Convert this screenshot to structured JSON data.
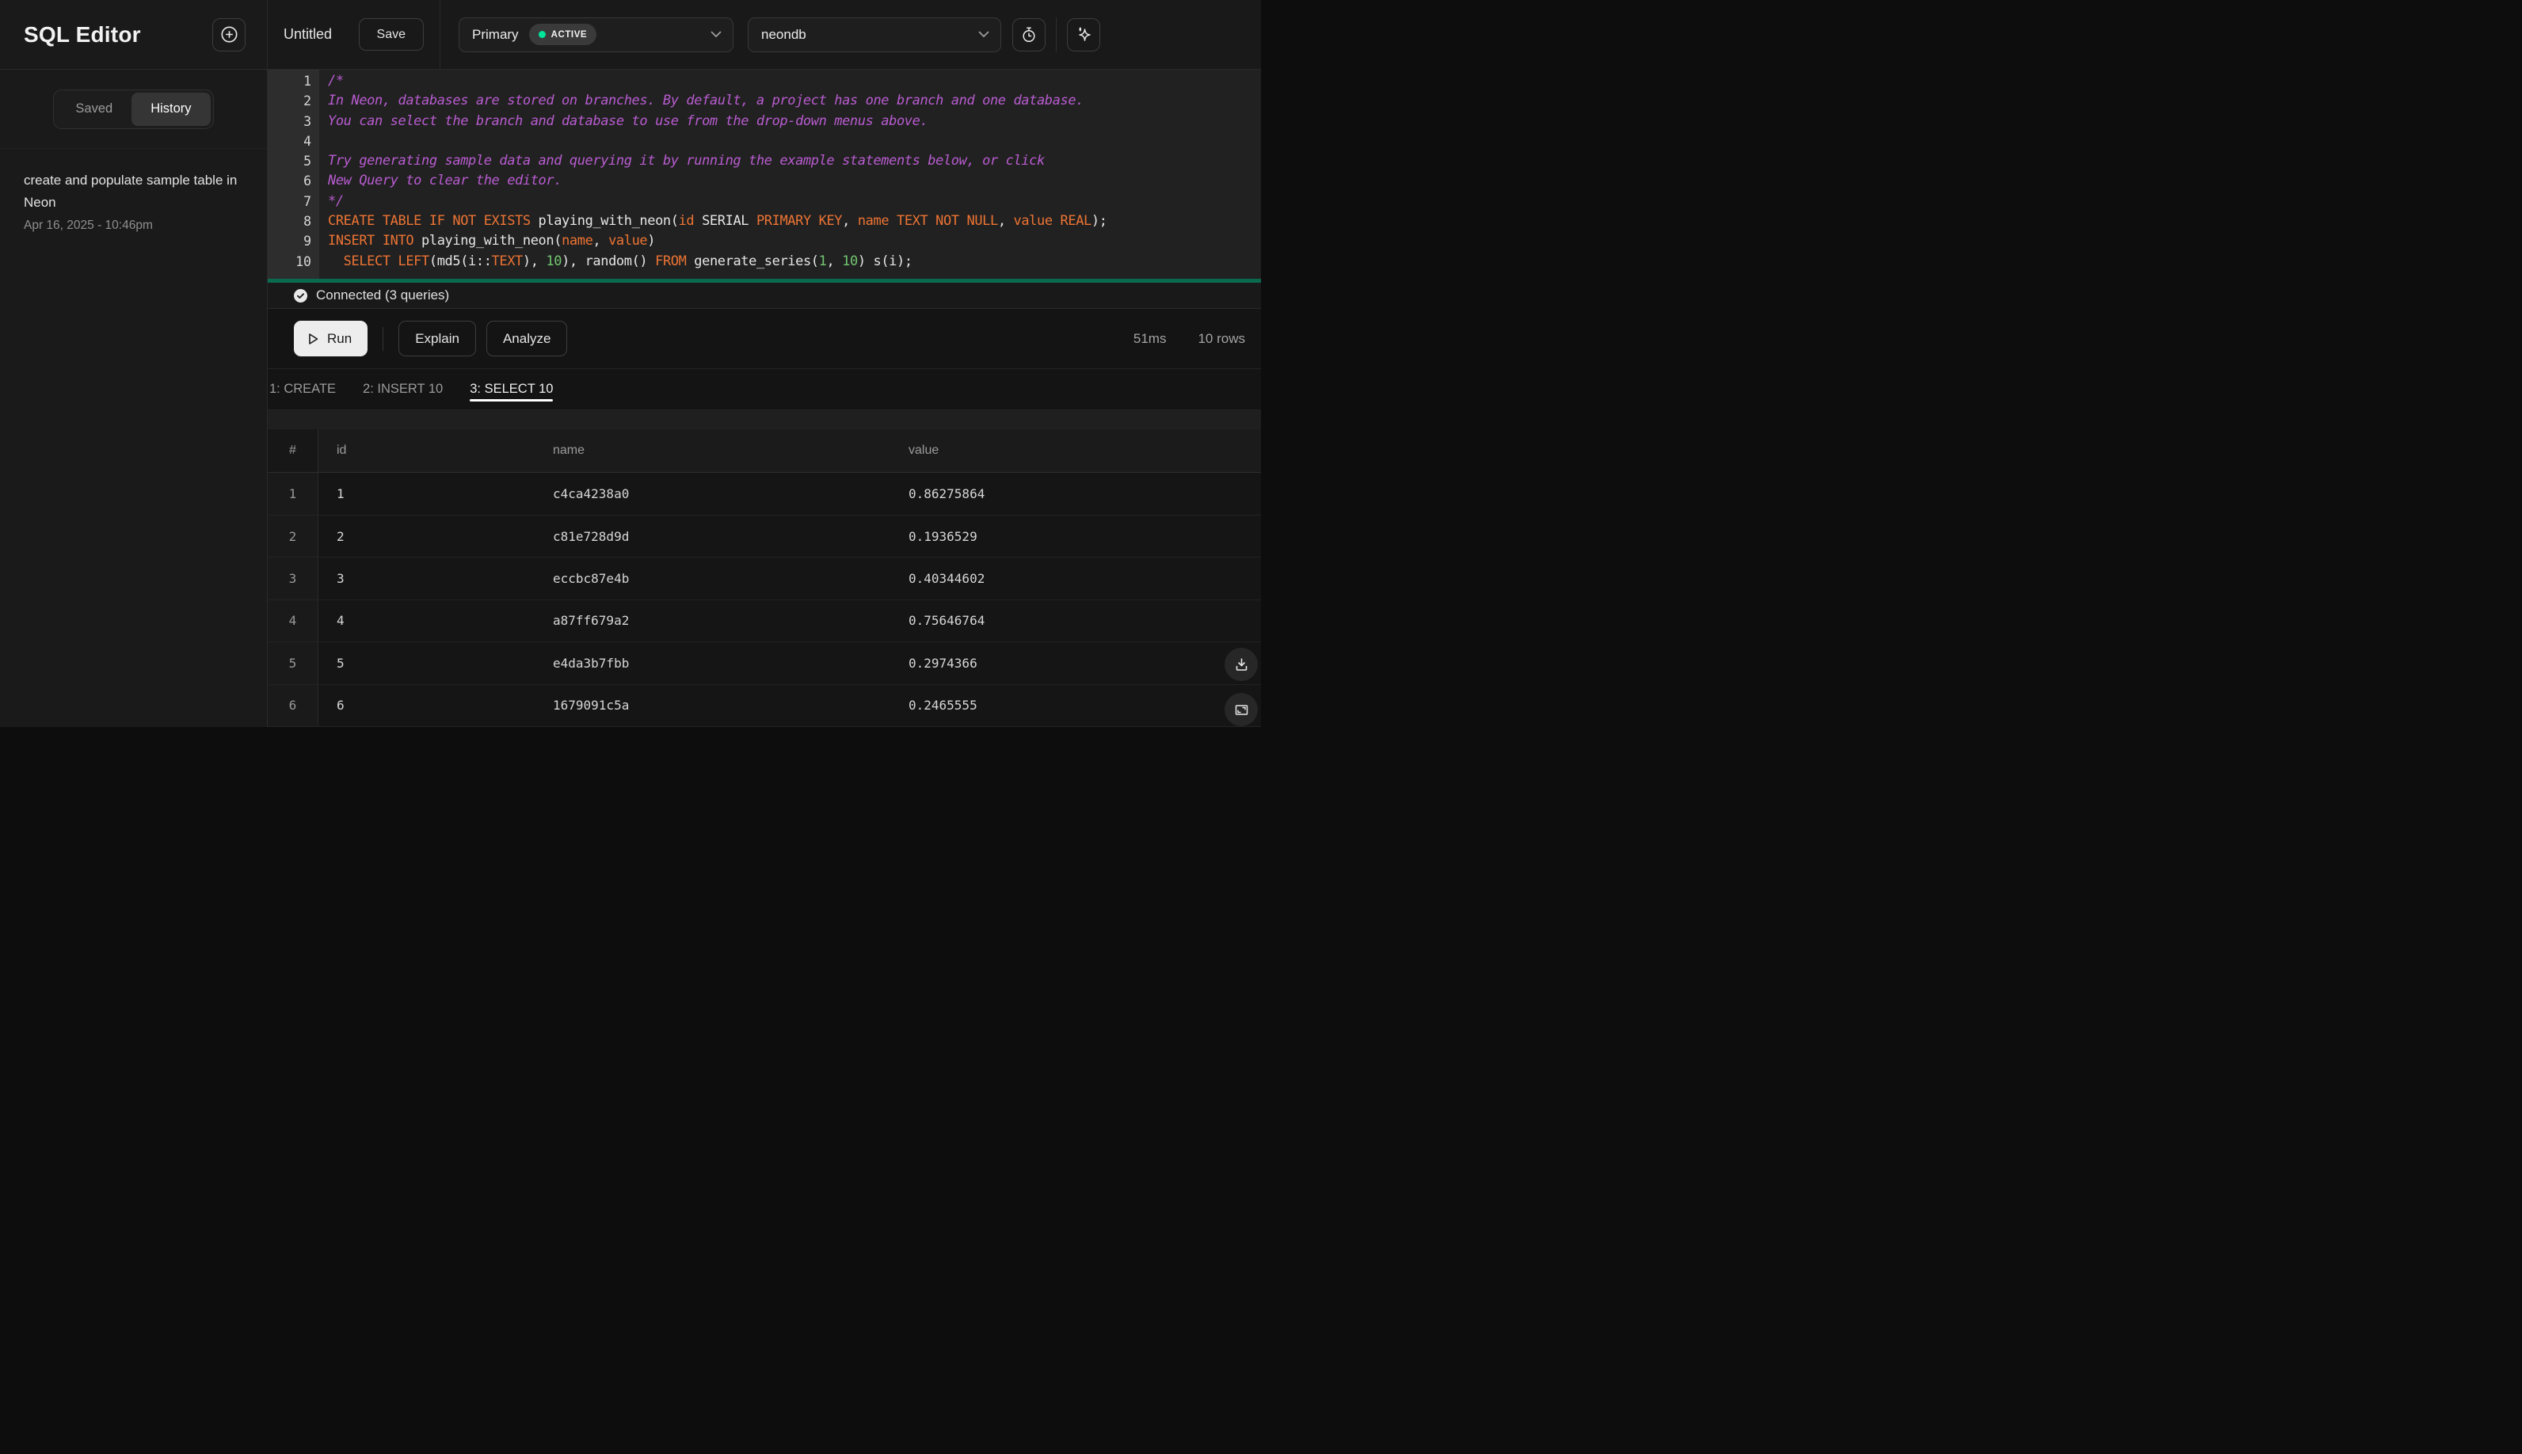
{
  "sidebar": {
    "title": "SQL Editor",
    "tabs": {
      "saved": "Saved",
      "history": "History",
      "active": "History"
    },
    "history_items": [
      {
        "title": "create and populate sample table in Neon",
        "timestamp": "Apr 16, 2025 - 10:46pm"
      }
    ]
  },
  "topbar": {
    "query_name": "Untitled",
    "save_label": "Save",
    "branch_select": {
      "value": "Primary",
      "badge": "ACTIVE",
      "badge_dot_color": "#00e599"
    },
    "database_select": {
      "value": "neondb"
    }
  },
  "editor": {
    "syntax_colors": {
      "comment": "#b95cd1",
      "keyword": "#ed7434",
      "number": "#72c772",
      "plain": "#e6e6e6",
      "bottom_bar": "#0a6a4e"
    },
    "lines": [
      {
        "num": "1",
        "tokens": [
          {
            "c": "comment",
            "t": "/*"
          }
        ]
      },
      {
        "num": "2",
        "tokens": [
          {
            "c": "comment",
            "t": "In Neon, databases are stored on branches. By default, a project has one branch and one database."
          }
        ]
      },
      {
        "num": "3",
        "tokens": [
          {
            "c": "comment",
            "t": "You can select the branch and database to use from the drop-down menus above."
          }
        ]
      },
      {
        "num": "4",
        "tokens": []
      },
      {
        "num": "5",
        "tokens": [
          {
            "c": "comment",
            "t": "Try generating sample data and querying it by running the example statements below, or click"
          }
        ]
      },
      {
        "num": "6",
        "tokens": [
          {
            "c": "comment",
            "t": "New Query to clear the editor."
          }
        ]
      },
      {
        "num": "7",
        "tokens": [
          {
            "c": "comment",
            "t": "*/"
          }
        ]
      },
      {
        "num": "8",
        "tokens": [
          {
            "c": "kw",
            "t": "CREATE TABLE IF NOT EXISTS"
          },
          {
            "c": "plain",
            "t": " playing_with_neon("
          },
          {
            "c": "kw",
            "t": "id"
          },
          {
            "c": "plain",
            "t": " SERIAL "
          },
          {
            "c": "kw",
            "t": "PRIMARY KEY"
          },
          {
            "c": "plain",
            "t": ", "
          },
          {
            "c": "kw",
            "t": "name TEXT NOT NULL"
          },
          {
            "c": "plain",
            "t": ", "
          },
          {
            "c": "kw",
            "t": "value REAL"
          },
          {
            "c": "plain",
            "t": ");"
          }
        ]
      },
      {
        "num": "9",
        "tokens": [
          {
            "c": "kw",
            "t": "INSERT INTO"
          },
          {
            "c": "plain",
            "t": " playing_with_neon("
          },
          {
            "c": "kw",
            "t": "name"
          },
          {
            "c": "plain",
            "t": ", "
          },
          {
            "c": "kw",
            "t": "value"
          },
          {
            "c": "plain",
            "t": ")"
          }
        ]
      },
      {
        "num": "10",
        "tokens": [
          {
            "c": "plain",
            "t": "  "
          },
          {
            "c": "kw",
            "t": "SELECT LEFT"
          },
          {
            "c": "plain",
            "t": "(md5(i::"
          },
          {
            "c": "kw",
            "t": "TEXT"
          },
          {
            "c": "plain",
            "t": "), "
          },
          {
            "c": "num",
            "t": "10"
          },
          {
            "c": "plain",
            "t": "), random() "
          },
          {
            "c": "kw",
            "t": "FROM"
          },
          {
            "c": "plain",
            "t": " generate_series("
          },
          {
            "c": "num",
            "t": "1"
          },
          {
            "c": "plain",
            "t": ", "
          },
          {
            "c": "num",
            "t": "10"
          },
          {
            "c": "plain",
            "t": ") s(i);"
          }
        ]
      }
    ]
  },
  "status": {
    "connected_label": "Connected (3 queries)"
  },
  "actions": {
    "run": "Run",
    "explain": "Explain",
    "analyze": "Analyze",
    "duration": "51ms",
    "row_count": "10 rows"
  },
  "result_tabs": [
    {
      "label": "1: CREATE",
      "active": false
    },
    {
      "label": "2: INSERT 10",
      "active": false
    },
    {
      "label": "3: SELECT 10",
      "active": true
    }
  ],
  "results": {
    "columns": [
      "#",
      "id",
      "name",
      "value"
    ],
    "rows": [
      [
        "1",
        "1",
        "c4ca4238a0",
        "0.86275864"
      ],
      [
        "2",
        "2",
        "c81e728d9d",
        "0.1936529"
      ],
      [
        "3",
        "3",
        "eccbc87e4b",
        "0.40344602"
      ],
      [
        "4",
        "4",
        "a87ff679a2",
        "0.75646764"
      ],
      [
        "5",
        "5",
        "e4da3b7fbb",
        "0.2974366"
      ],
      [
        "6",
        "6",
        "1679091c5a",
        "0.2465555"
      ]
    ]
  },
  "colors": {
    "accent_green": "#00e599",
    "editor_bottom_bar": "#0a6a4e",
    "active_tab_underline": "#ffffff"
  }
}
